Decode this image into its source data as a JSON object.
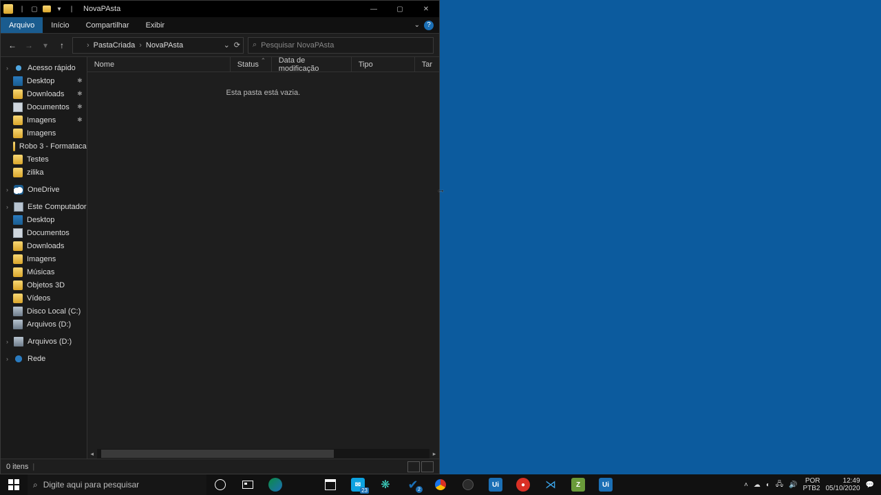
{
  "window": {
    "title": "NovaPAsta"
  },
  "ribbon": {
    "file": "Arquivo",
    "tabs": [
      "Início",
      "Compartilhar",
      "Exibir"
    ]
  },
  "breadcrumb": {
    "parts": [
      "PastaCriada",
      "NovaPAsta"
    ]
  },
  "search": {
    "placeholder": "Pesquisar NovaPAsta"
  },
  "columns": {
    "name": "Nome",
    "status": "Status",
    "modified": "Data de modificação",
    "type": "Tipo",
    "size": "Tar"
  },
  "empty": "Esta pasta está vazia.",
  "sidebar": {
    "quick_access": "Acesso rápido",
    "quick_items": [
      {
        "label": "Desktop",
        "pinned": true
      },
      {
        "label": "Downloads",
        "pinned": true
      },
      {
        "label": "Documentos",
        "pinned": true
      },
      {
        "label": "Imagens",
        "pinned": true
      },
      {
        "label": "Imagens",
        "pinned": false
      },
      {
        "label": "Robo 3 - Formataca",
        "pinned": false
      },
      {
        "label": "Testes",
        "pinned": false
      },
      {
        "label": "zilika",
        "pinned": false
      }
    ],
    "onedrive": "OneDrive",
    "this_pc": "Este Computador",
    "pc_items": [
      "Desktop",
      "Documentos",
      "Downloads",
      "Imagens",
      "Músicas",
      "Objetos 3D",
      "Vídeos",
      "Disco Local (C:)",
      "Arquivos (D:)"
    ],
    "drive_ext": "Arquivos (D:)",
    "network": "Rede"
  },
  "status": {
    "items": "0 itens"
  },
  "taskbar": {
    "search": "Digite aqui para pesquisar",
    "badges": {
      "explorer": "23",
      "studio": "2"
    }
  },
  "tray": {
    "lang": "POR",
    "kbd": "PTB2",
    "time": "12:49",
    "date": "05/10/2020"
  }
}
